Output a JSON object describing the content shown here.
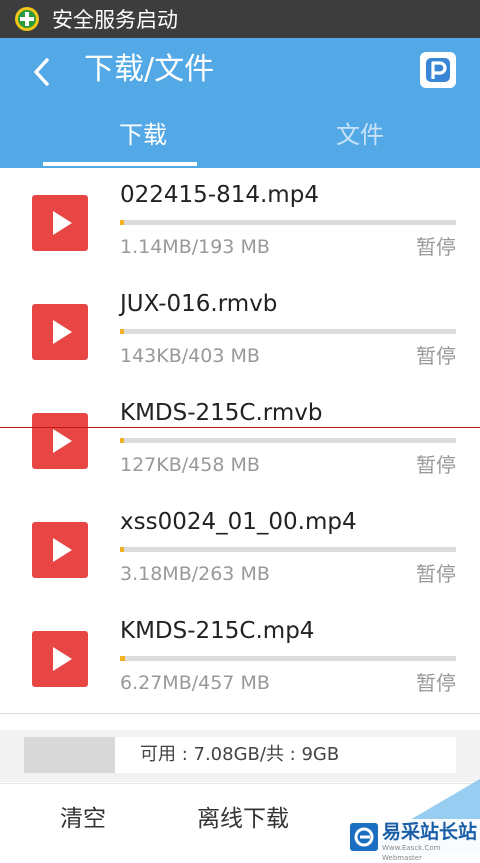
{
  "status_bar": {
    "text": "安全服务启动"
  },
  "app_bar": {
    "title": "下载/文件",
    "tabs": [
      {
        "label": "下载",
        "active": true
      },
      {
        "label": "文件",
        "active": false
      }
    ]
  },
  "downloads": [
    {
      "name": "022415-814.mp4",
      "size": "1.14MB/193 MB",
      "progress": 0.006,
      "action": "暂停"
    },
    {
      "name": "JUX-016.rmvb",
      "size": "143KB/403 MB",
      "progress": 0.0004,
      "action": "暂停"
    },
    {
      "name": "KMDS-215C.rmvb",
      "size": "127KB/458 MB",
      "progress": 0.0003,
      "action": "暂停"
    },
    {
      "name": "xss0024_01_00.mp4",
      "size": "3.18MB/263 MB",
      "progress": 0.012,
      "action": "暂停"
    },
    {
      "name": "KMDS-215C.mp4",
      "size": "6.27MB/457 MB",
      "progress": 0.014,
      "action": "暂停"
    }
  ],
  "storage": {
    "label": "可用 : 7.08GB/共 : 9GB",
    "used_fraction": 0.21
  },
  "bottom_bar": {
    "clear_label": "清空",
    "offline_label": "离线下载"
  },
  "watermark": {
    "text": "易采站长站",
    "sub": "Www.Easck.Com Webmaster"
  },
  "colors": {
    "app_bar": "#53a8e6",
    "play_button": "#e84545",
    "progress": "#f2b21e",
    "status_bar": "#3d3d3d"
  }
}
